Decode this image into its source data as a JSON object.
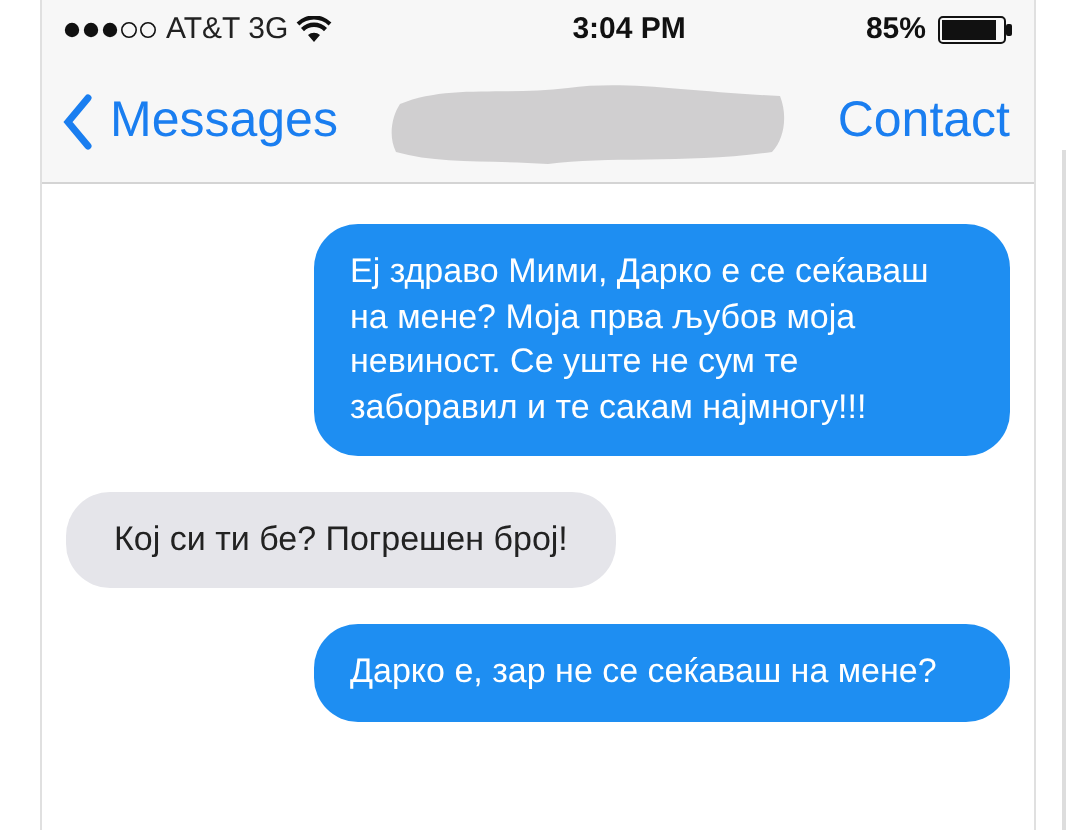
{
  "status_bar": {
    "carrier": "AT&T 3G",
    "time": "3:04 PM",
    "battery": "85%"
  },
  "nav_bar": {
    "back": "Messages",
    "action": "Contact"
  },
  "messages": [
    {
      "kind": "sent",
      "text": "Еј здраво Мими, Дарко е се сеќаваш на мене? Моја прва љубов моја невиност. Се уште не сум те заборавил и те сакам најмногу!!!"
    },
    {
      "kind": "received",
      "text": "Кој си ти бе? Погрешен број!"
    },
    {
      "kind": "sent",
      "text": "Дарко е, зар не се сеќаваш на мене?"
    }
  ]
}
